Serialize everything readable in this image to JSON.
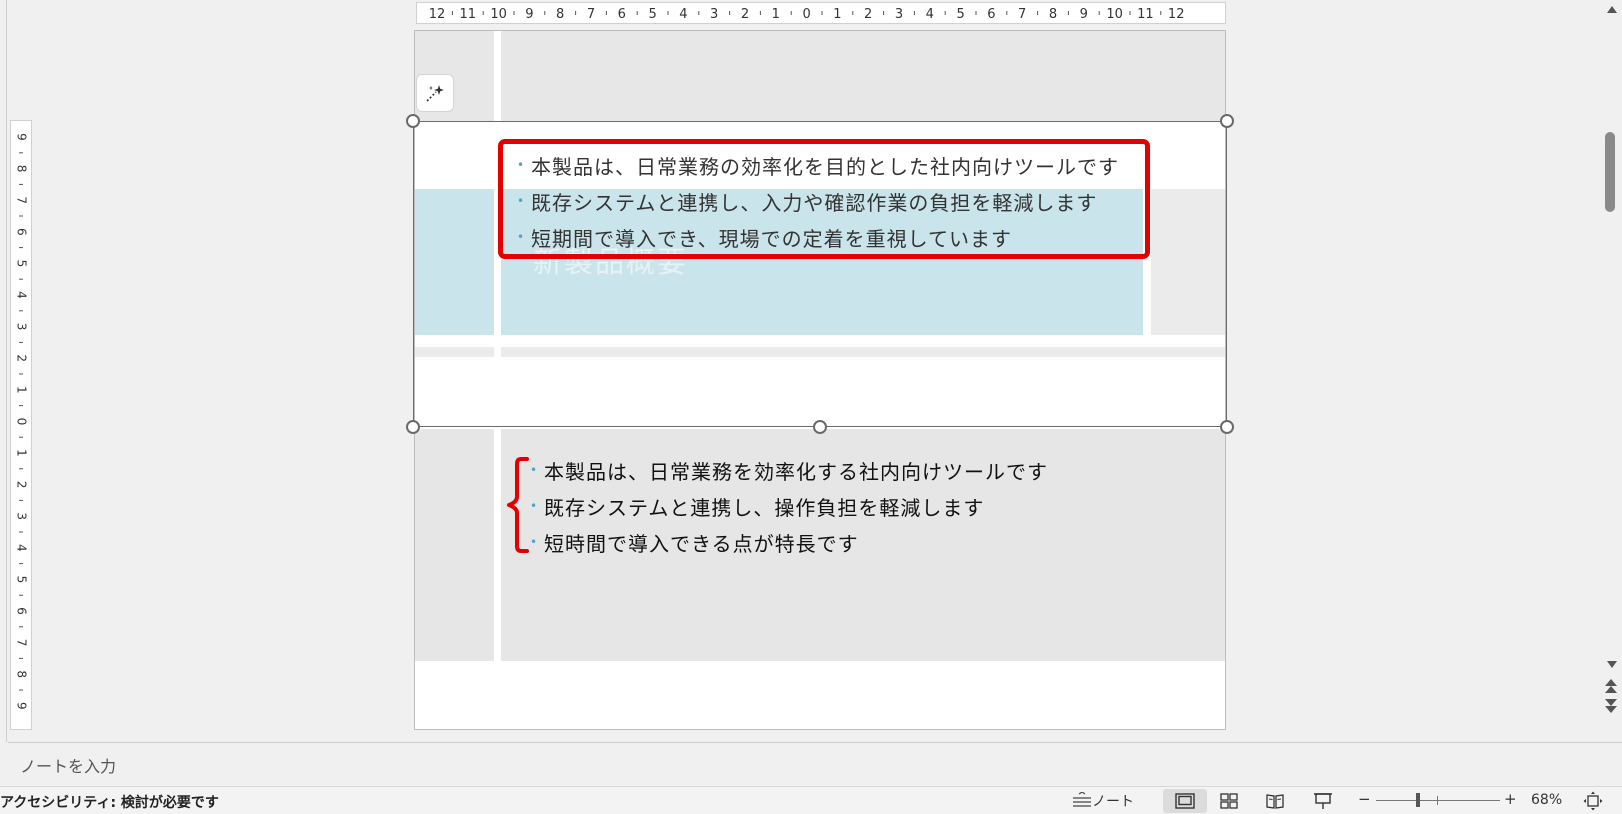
{
  "slide": {
    "title": "新製品概要",
    "bullets_upper": [
      "本製品は、日常業務の効率化を目的とした社内向けツールです",
      "既存システムと連携し、入力や確認作業の負担を軽減します",
      "短期間で導入でき、現場での定着を重視しています"
    ],
    "bullets_lower": [
      "本製品は、日常業務を効率化する社内向けツールです",
      "既存システムと連携し、操作負担を軽減します",
      "短時間で導入できる点が特長です"
    ]
  },
  "ruler": {
    "horizontal_labels": [
      "12",
      "11",
      "10",
      "9",
      "8",
      "7",
      "6",
      "5",
      "4",
      "3",
      "2",
      "1",
      "0",
      "1",
      "2",
      "3",
      "4",
      "5",
      "6",
      "7",
      "8",
      "9",
      "10",
      "11",
      "12"
    ],
    "vertical_labels": [
      "9",
      "8",
      "7",
      "6",
      "5",
      "4",
      "3",
      "2",
      "1",
      "0",
      "1",
      "2",
      "3",
      "4",
      "5",
      "6",
      "7",
      "8",
      "9"
    ]
  },
  "notes": {
    "placeholder": "ノートを入力"
  },
  "status_bar": {
    "accessibility": "アクセシビリティ: 検討が必要です",
    "notes_label": "ノート",
    "zoom_minus": "−",
    "zoom_plus": "+",
    "zoom_level": "68%",
    "zoom_fraction": 0.34
  },
  "icons": {
    "designer": "sparkle-wand-icon",
    "notes": "notes-icon",
    "normal_view": "normal-view-icon",
    "slide_sorter": "slide-sorter-icon",
    "reading_view": "reading-view-icon",
    "slideshow": "slideshow-icon",
    "fit": "fit-to-window-icon"
  },
  "colors": {
    "highlight": "#e30000",
    "title_fill": "#b5dae2",
    "bullet": "#4aa7c6"
  }
}
